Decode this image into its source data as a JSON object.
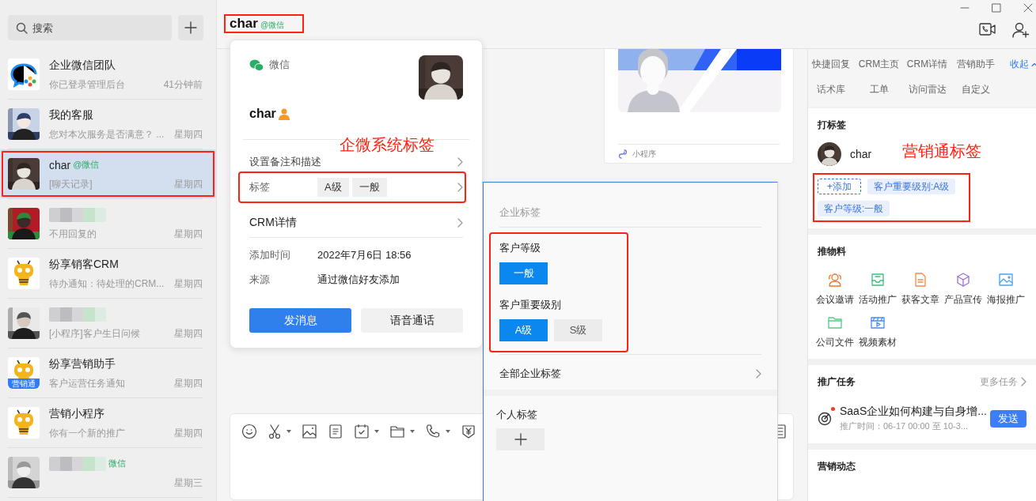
{
  "sidebar": {
    "search": {
      "placeholder": "搜索"
    },
    "chats": [
      {
        "name": "企业微信团队",
        "preview": "你已登录管理后台",
        "time": "41分钟前",
        "kind": "logo",
        "selected": false,
        "highlighted": false,
        "redacted": false
      },
      {
        "name": "我的客服",
        "preview": "您对本次服务是否满意？ ...",
        "time": "星期四",
        "kind": "picture",
        "selected": false,
        "highlighted": false,
        "redacted": false
      },
      {
        "name": "char",
        "source": "@微信",
        "preview": "[聊天记录]",
        "time": "星期四",
        "kind": "picture",
        "selected": true,
        "highlighted": true,
        "redacted": false
      },
      {
        "preview": "不用回复的",
        "time": "星期四",
        "kind": "picture",
        "selected": false,
        "highlighted": false,
        "redacted": true
      },
      {
        "name": "纷享销客CRM",
        "preview": "待办通知：待处理的CRM...",
        "time": "星期四",
        "kind": "mascot",
        "selected": false,
        "highlighted": false,
        "redacted": false
      },
      {
        "preview": "[小程序]客户生日问候",
        "time": "星期四",
        "kind": "picture",
        "selected": false,
        "highlighted": false,
        "redacted": true
      },
      {
        "name": "纷享营销助手",
        "preview": "客户运营任务通知",
        "time": "星期四",
        "kind": "mascot",
        "badge": "营销通",
        "selected": false,
        "highlighted": false,
        "redacted": false
      },
      {
        "name": "营销小程序",
        "preview": "你有一个新的推广",
        "time": "星期四",
        "kind": "mascot",
        "selected": false,
        "highlighted": false,
        "redacted": false
      },
      {
        "source": "微信",
        "time": "星期三",
        "kind": "picture",
        "selected": false,
        "highlighted": false,
        "redacted": true
      }
    ]
  },
  "header": {
    "title": "char",
    "source": "@微信",
    "highlighted": true
  },
  "chat": {
    "mini_program": {
      "label": "小程序"
    }
  },
  "contact_card": {
    "source": "微信",
    "name": "char",
    "annotation": "企微系统标签",
    "rows": [
      {
        "kind": "link",
        "label": "设置备注和描述"
      },
      {
        "kind": "tags",
        "label": "标签",
        "tags": [
          "A级",
          "一般"
        ],
        "highlighted": true
      },
      {
        "kind": "link",
        "label": "CRM详情"
      },
      {
        "kind": "info",
        "label": "添加时间",
        "value": "2022年7月6日 18:56"
      },
      {
        "kind": "info",
        "label": "来源",
        "value": "通过微信好友添加"
      }
    ],
    "buttons": [
      {
        "label": "发消息",
        "primary": true
      },
      {
        "label": "语音通话",
        "primary": false
      }
    ]
  },
  "tag_panel": {
    "title": "企业标签",
    "groups_highlighted": true,
    "groups": [
      {
        "name": "客户等级",
        "tags": [
          {
            "label": "一般",
            "selected": true
          }
        ]
      },
      {
        "name": "客户重要级别",
        "tags": [
          {
            "label": "A级",
            "selected": true
          },
          {
            "label": "S级",
            "selected": false
          }
        ]
      }
    ],
    "all_link": "全部企业标签",
    "personal_title": "个人标签"
  },
  "side_panel": {
    "tab_rows": [
      [
        "快捷回复",
        "CRM主页",
        "CRM详情",
        "营销助手"
      ],
      [
        "话术库",
        "工单",
        "访问雷达",
        "自定义"
      ]
    ],
    "collapse": "收起",
    "tagging": {
      "title": "打标签",
      "name": "char",
      "annotation": "营销通标签",
      "add": "+添加",
      "tags": [
        "客户重要级别:A级",
        "客户等级:一般"
      ],
      "highlighted": true
    },
    "materials": {
      "title": "推物料",
      "items": [
        "会议邀请",
        "活动推广",
        "获客文章",
        "产品宣传",
        "海报推广",
        "公司文件",
        "视频素材"
      ]
    },
    "tasks": {
      "title": "推广任务",
      "more": "更多任务",
      "items": [
        {
          "title": "SaaS企业如何构建与自身增...",
          "time": "推广时间：06-17 00:00 至 10-3...",
          "button": "发送",
          "unread": true
        }
      ]
    },
    "activity": {
      "title": "营销动态"
    }
  }
}
